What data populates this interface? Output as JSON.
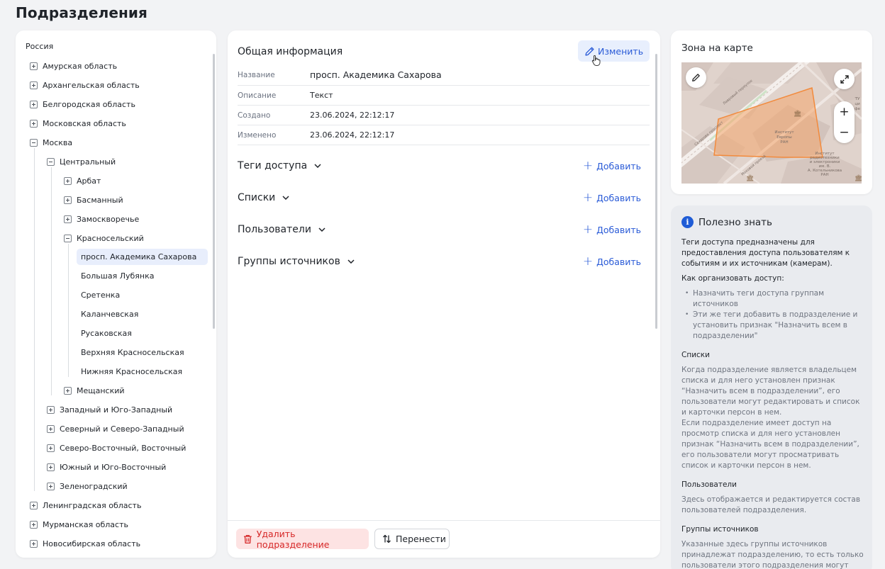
{
  "page": {
    "title": "Подразделения"
  },
  "tree": {
    "root": "Россия",
    "n": {
      "amur": "Амурская область",
      "arkh": "Архангельская область",
      "belg": "Белгородская область",
      "mosobl": "Московская область",
      "moscow": "Москва",
      "central": "Центральный",
      "arbat": "Арбат",
      "basman": "Басманный",
      "zamosk": "Замоскворечье",
      "krasnosel": "Красносельский",
      "sakharova": "просп. Академика Сахарова",
      "lubyanka": "Большая Лубянка",
      "sretenka": "Сретенка",
      "kalanch": "Каланчевская",
      "rusak": "Русаковская",
      "verkh": "Верхняя Красносельская",
      "nizh": "Нижняя Красносельская",
      "meshch": "Мещанский",
      "zapad": "Западный и Юго-Западный",
      "sever": "Северный и Северо-Западный",
      "sevvost": "Северо-Восточный, Восточный",
      "yuzh": "Южный и Юго-Восточный",
      "zelen": "Зеленоградский",
      "leningr": "Ленинградская область",
      "murm": "Мурманская область",
      "novosib": "Новосибирская область"
    }
  },
  "details": {
    "section_title": "Общая информация",
    "edit_label": "Изменить",
    "fields": {
      "name_label": "Название",
      "name_value": "просп. Академика Сахарова",
      "desc_label": "Описание",
      "desc_value": "Текст",
      "created_label": "Создано",
      "created_value": "23.06.2024, 22:12:17",
      "changed_label": "Изменено",
      "changed_value": "23.06.2024, 22:12:17"
    },
    "accordions": {
      "tags": "Теги доступа",
      "lists": "Списки",
      "users": "Пользователи",
      "groups": "Группы источников",
      "add_label": "Добавить"
    },
    "delete_label": "Удалить подразделение",
    "move_label": "Перенести"
  },
  "map": {
    "title": "Зона на карте",
    "zoom_in": "+",
    "zoom_out": "−",
    "labels": {
      "institute_europe": [
        "Институт",
        "Европы",
        "РАН"
      ],
      "institute_radio": [
        "Институт",
        "радиотехники",
        "и электроники",
        "им. В.",
        "А. Котельникова",
        "РАН"
      ],
      "street_sakharova": "Сахарова проспект",
      "street_lane": "Лавровый переулок",
      "street_mokhov": "Моховой проезд",
      "tu": "ТУ",
      "ci": "ци",
      "fe": "фе"
    }
  },
  "tips": {
    "title": "Полезно знать",
    "info_glyph": "i",
    "intro": "Теги доступа предназначены для предоставления доступа пользователям к событиям и их источникам (камерам).",
    "how_title": "Как организовать доступ:",
    "bullet1": "Назначить теги доступа группам источников",
    "bullet2": "Эти же теги добавить в подразделение и установить признак \"Назначить всем в подразделении\"",
    "lists_title": "Списки",
    "lists_text1": "Когда подразделение является владельцем списка и для него установлен признак “Назначить всем в подразделении”, его пользователи могут редактировать и список и карточки персон в нем.",
    "lists_text2": "Если подразделение имеет доступ на просмотр списка и для него установлен признак “Назначить всем в подразделении”,  его пользователи могут просматривать список и карточки персон в нем.",
    "users_title": "Пользователи",
    "users_text": "Здесь отображается и редактируется состав пользователей подразделения.",
    "groups_title": "Группы источников",
    "groups_text": "Указанные здесь группы источников принадлежат подразделению, то есть только пользователи этого подразделения могут редактировать группы и источники в них."
  }
}
